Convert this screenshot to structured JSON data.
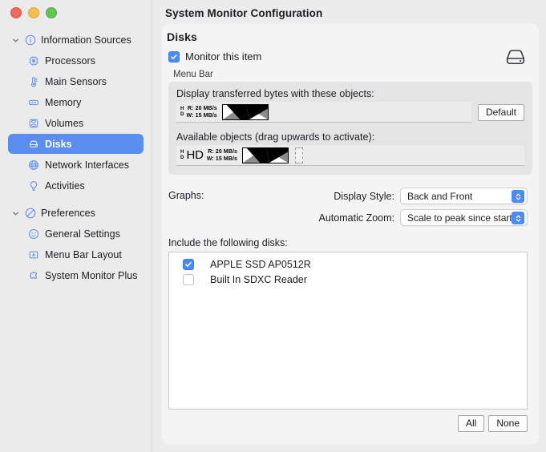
{
  "window": {
    "title": "System Monitor Configuration",
    "traffic_lights": [
      "close",
      "minimize",
      "zoom"
    ]
  },
  "sidebar": {
    "groups": [
      {
        "label": "Information Sources",
        "icon": "info-circle-icon",
        "expanded": true,
        "items": [
          {
            "label": "Processors",
            "icon": "cpu-chip-icon",
            "selected": false
          },
          {
            "label": "Main Sensors",
            "icon": "thermometer-icon",
            "selected": false
          },
          {
            "label": "Memory",
            "icon": "memory-icon",
            "selected": false
          },
          {
            "label": "Volumes",
            "icon": "database-cylinder-icon",
            "selected": false
          },
          {
            "label": "Disks",
            "icon": "hard-drive-icon",
            "selected": true
          },
          {
            "label": "Network Interfaces",
            "icon": "globe-icon",
            "selected": false
          },
          {
            "label": "Activities",
            "icon": "lightbulb-icon",
            "selected": false
          }
        ]
      },
      {
        "label": "Preferences",
        "icon": "slash-circle-icon",
        "expanded": true,
        "items": [
          {
            "label": "General Settings",
            "icon": "smiley-circle-icon",
            "selected": false
          },
          {
            "label": "Menu Bar Layout",
            "icon": "menubar-icon",
            "selected": false
          },
          {
            "label": "System Monitor Plus",
            "icon": "puzzle-piece-icon",
            "selected": false
          }
        ]
      }
    ]
  },
  "main": {
    "heading": "Disks",
    "monitor_checkbox": {
      "label": "Monitor this item",
      "checked": true
    },
    "header_icon": "hard-drive-icon",
    "menu_bar_section_label": "Menu Bar",
    "groupbox": {
      "display_caption": "Display transferred bytes with these objects:",
      "available_caption": "Available objects (drag upwards to activate):",
      "default_button": "Default",
      "active_widget": {
        "prefix_top": "H",
        "prefix_bottom": "D",
        "read": "R: 20 MB/s",
        "write": "W: 15 MB/s"
      },
      "available_widget": {
        "prefix_top": "H",
        "prefix_bottom": "D",
        "title": "HD",
        "read": "R: 20 MB/s",
        "write": "W: 15 MB/s"
      }
    },
    "graphs": {
      "label": "Graphs:",
      "display_style": {
        "label": "Display Style:",
        "value": "Back and Front"
      },
      "automatic_zoom": {
        "label": "Automatic Zoom:",
        "value": "Scale to peak since start"
      }
    },
    "disks": {
      "caption": "Include the following disks:",
      "items": [
        {
          "label": "APPLE SSD AP0512R",
          "checked": true
        },
        {
          "label": "Built In SDXC Reader",
          "checked": false
        }
      ],
      "all_button": "All",
      "none_button": "None"
    }
  },
  "colors": {
    "accent": "#4a8bf5",
    "selection": "#5b8def",
    "sidebar_bg": "#ebebeb",
    "card_bg": "#f4f4f4",
    "groupbox_bg": "#e4e4e4"
  }
}
